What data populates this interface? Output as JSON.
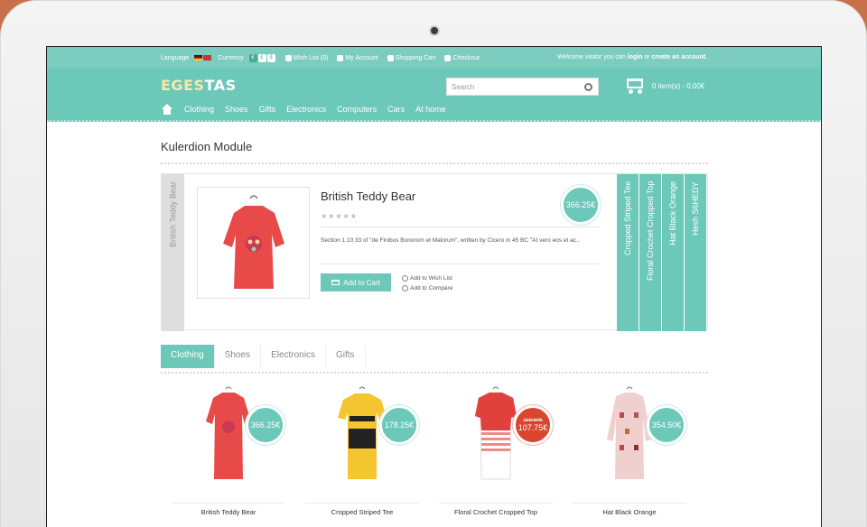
{
  "topbar": {
    "language_label": "Language",
    "currency_label": "Currency",
    "currencies": [
      "€",
      "£",
      "$"
    ],
    "links": [
      "Wish List (0)",
      "My Account",
      "Shopping Cart",
      "Checkout"
    ],
    "welcome_prefix": "Welcome visitor you can",
    "login": "login",
    "or": "or",
    "create_account": "create an account."
  },
  "header": {
    "logo_part1": "EGES",
    "logo_part2": "TAS",
    "search_placeholder": "Search",
    "cart_info": "0 item(s) - 0.00€"
  },
  "nav": {
    "items": [
      "Clothing",
      "Shoes",
      "Gifts",
      "Electronics",
      "Computers",
      "Cars",
      "At home"
    ]
  },
  "module": {
    "title": "Kulerdion Module",
    "active_tab": "British Teddy Bear",
    "right_tabs": [
      "Cropped Striped Tee",
      "Floral Crochet Cropped Top",
      "Hat Black Orange",
      "Hesh S6HEDY"
    ],
    "product_name": "British Teddy Bear",
    "stars": "★★★★★",
    "price": "366.25€",
    "description": "Section 1.10.33 of \"de Finibus Bonorum et Malorum\", written by Cicero in 45 BC \"At vero eos et ac..",
    "add_to_cart": "Add to Cart",
    "add_to_wishlist": "Add to Wish List",
    "add_to_compare": "Add to Compare"
  },
  "category_tabs": [
    "Clothing",
    "Shoes",
    "Electronics",
    "Gifts"
  ],
  "products": [
    {
      "name": "British Teddy Bear",
      "price": "366.25€",
      "old_price": "",
      "sale": false
    },
    {
      "name": "Cropped Striped Tee",
      "price": "178.25€",
      "old_price": "",
      "sale": false
    },
    {
      "name": "Floral Crochet Cropped Top",
      "price": "107.75€",
      "old_price": "119.50€",
      "sale": true
    },
    {
      "name": "Hat Black Orange",
      "price": "354.50€",
      "old_price": "",
      "sale": false
    }
  ],
  "colors": {
    "accent": "#6cc8b9",
    "sale": "#d9452e"
  }
}
